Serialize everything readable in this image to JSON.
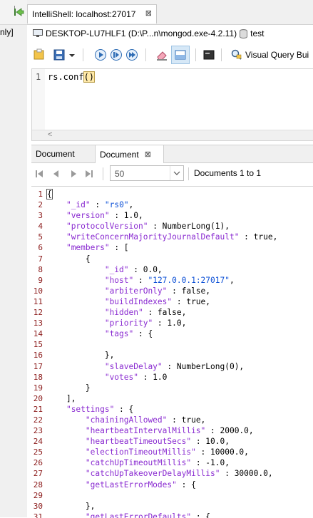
{
  "left_pane": {
    "cut_text": "nly]"
  },
  "tab": {
    "title": "IntelliShell: localhost:27017",
    "close_glyph": "⊠"
  },
  "connection": {
    "label": "DESKTOP-LU7HLF1 (D:\\P...n\\mongod.exe-4.2.11)",
    "database": "test"
  },
  "toolbar": {
    "visual_query_label": "Visual Query Bui"
  },
  "editor": {
    "line_number": "1",
    "code_before": "rs.conf",
    "code_parens": "()",
    "scroll_arrow": "<"
  },
  "results": {
    "tabs": [
      {
        "label": "Document"
      },
      {
        "label": "Document",
        "close_glyph": "⊠"
      }
    ],
    "page_size": "50",
    "count_text": "Documents 1 to 1"
  },
  "document_lines": [
    [
      [
        "p",
        "{"
      ]
    ],
    [
      [
        "i",
        "    "
      ],
      [
        "k",
        "\"_id\""
      ],
      [
        "p",
        " : "
      ],
      [
        "s",
        "\"rs0\""
      ],
      [
        "p",
        ","
      ]
    ],
    [
      [
        "i",
        "    "
      ],
      [
        "k",
        "\"version\""
      ],
      [
        "p",
        " : 1.0,"
      ]
    ],
    [
      [
        "i",
        "    "
      ],
      [
        "k",
        "\"protocolVersion\""
      ],
      [
        "p",
        " : NumberLong(1),"
      ]
    ],
    [
      [
        "i",
        "    "
      ],
      [
        "k",
        "\"writeConcernMajorityJournalDefault\""
      ],
      [
        "p",
        " : true,"
      ]
    ],
    [
      [
        "i",
        "    "
      ],
      [
        "k",
        "\"members\""
      ],
      [
        "p",
        " : ["
      ]
    ],
    [
      [
        "i",
        "        "
      ],
      [
        "p",
        "{"
      ]
    ],
    [
      [
        "i",
        "            "
      ],
      [
        "k",
        "\"_id\""
      ],
      [
        "p",
        " : 0.0,"
      ]
    ],
    [
      [
        "i",
        "            "
      ],
      [
        "k",
        "\"host\""
      ],
      [
        "p",
        " : "
      ],
      [
        "s",
        "\"127.0.0.1:27017\""
      ],
      [
        "p",
        ","
      ]
    ],
    [
      [
        "i",
        "            "
      ],
      [
        "k",
        "\"arbiterOnly\""
      ],
      [
        "p",
        " : false,"
      ]
    ],
    [
      [
        "i",
        "            "
      ],
      [
        "k",
        "\"buildIndexes\""
      ],
      [
        "p",
        " : true,"
      ]
    ],
    [
      [
        "i",
        "            "
      ],
      [
        "k",
        "\"hidden\""
      ],
      [
        "p",
        " : false,"
      ]
    ],
    [
      [
        "i",
        "            "
      ],
      [
        "k",
        "\"priority\""
      ],
      [
        "p",
        " : 1.0,"
      ]
    ],
    [
      [
        "i",
        "            "
      ],
      [
        "k",
        "\"tags\""
      ],
      [
        "p",
        " : {"
      ]
    ],
    [
      [
        "i",
        ""
      ]
    ],
    [
      [
        "i",
        "            "
      ],
      [
        "p",
        "},"
      ]
    ],
    [
      [
        "i",
        "            "
      ],
      [
        "k",
        "\"slaveDelay\""
      ],
      [
        "p",
        " : NumberLong(0),"
      ]
    ],
    [
      [
        "i",
        "            "
      ],
      [
        "k",
        "\"votes\""
      ],
      [
        "p",
        " : 1.0"
      ]
    ],
    [
      [
        "i",
        "        "
      ],
      [
        "p",
        "}"
      ]
    ],
    [
      [
        "i",
        "    "
      ],
      [
        "p",
        "],"
      ]
    ],
    [
      [
        "i",
        "    "
      ],
      [
        "k",
        "\"settings\""
      ],
      [
        "p",
        " : {"
      ]
    ],
    [
      [
        "i",
        "        "
      ],
      [
        "k",
        "\"chainingAllowed\""
      ],
      [
        "p",
        " : true,"
      ]
    ],
    [
      [
        "i",
        "        "
      ],
      [
        "k",
        "\"heartbeatIntervalMillis\""
      ],
      [
        "p",
        " : 2000.0,"
      ]
    ],
    [
      [
        "i",
        "        "
      ],
      [
        "k",
        "\"heartbeatTimeoutSecs\""
      ],
      [
        "p",
        " : 10.0,"
      ]
    ],
    [
      [
        "i",
        "        "
      ],
      [
        "k",
        "\"electionTimeoutMillis\""
      ],
      [
        "p",
        " : 10000.0,"
      ]
    ],
    [
      [
        "i",
        "        "
      ],
      [
        "k",
        "\"catchUpTimeoutMillis\""
      ],
      [
        "p",
        " : -1.0,"
      ]
    ],
    [
      [
        "i",
        "        "
      ],
      [
        "k",
        "\"catchUpTakeoverDelayMillis\""
      ],
      [
        "p",
        " : 30000.0,"
      ]
    ],
    [
      [
        "i",
        "        "
      ],
      [
        "k",
        "\"getLastErrorModes\""
      ],
      [
        "p",
        " : {"
      ]
    ],
    [
      [
        "i",
        ""
      ]
    ],
    [
      [
        "i",
        "        "
      ],
      [
        "p",
        "},"
      ]
    ],
    [
      [
        "i",
        "        "
      ],
      [
        "k",
        "\"getLastErrorDefaults\""
      ],
      [
        "p",
        " : {"
      ]
    ]
  ],
  "colors": {
    "key": "#8a2bd1",
    "string": "#0b4fd6",
    "line_number": "#8b1a1a",
    "selection": "#d6e8f7"
  }
}
